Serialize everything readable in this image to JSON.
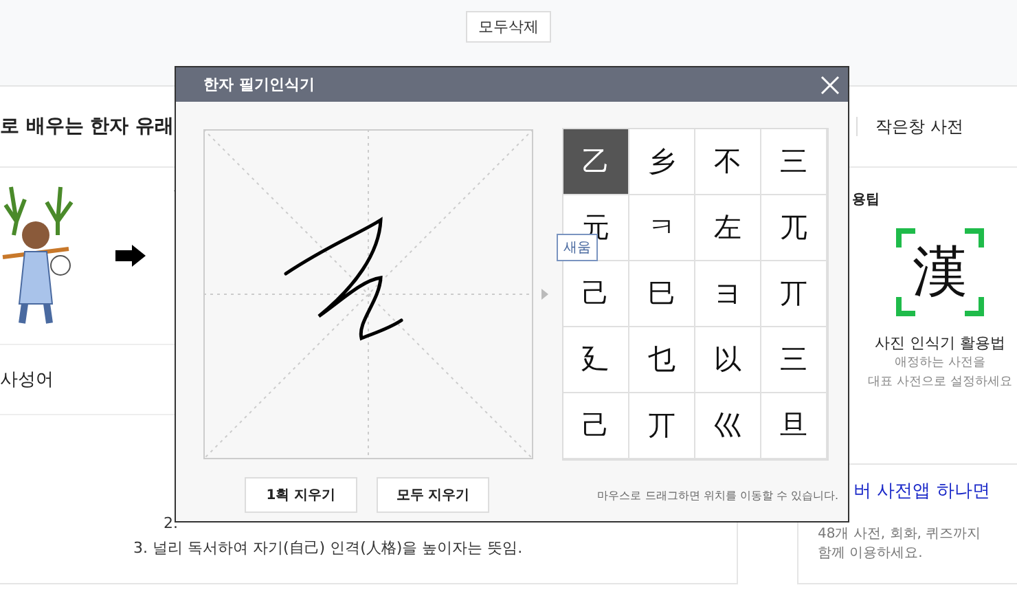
{
  "top_bar": {
    "clear_all_button": "모두삭제"
  },
  "left_panel": {
    "heading": "로 배우는 한자 유래",
    "section_heading": "사성어",
    "lines": [
      "2.",
      "3. 널리 독서하여 자기(自己) 인격(人格)을 높이자는 뜻임."
    ]
  },
  "right_panel": {
    "small_window_link": "작은창 사전",
    "tip_heading": "용팁",
    "photo_icon_char": "漢",
    "photo_title": "사진 인식기 활용법",
    "photo_desc": [
      "애정하는 사전을",
      "대표 사전으로 설정하세요"
    ],
    "ad": {
      "title": "버 사전앱 하나면",
      "desc": [
        "48개 사전, 회화, 퀴즈까지",
        "함께 이용하세요."
      ]
    }
  },
  "dialog": {
    "title": "한자 필기인식기",
    "candidates": [
      {
        "char": "乙",
        "selected": true
      },
      {
        "char": "乡",
        "selected": false
      },
      {
        "char": "不",
        "selected": false
      },
      {
        "char": "三",
        "selected": false
      },
      {
        "char": "元",
        "selected": false
      },
      {
        "char": "ㅋ",
        "selected": false
      },
      {
        "char": "左",
        "selected": false
      },
      {
        "char": "兀",
        "selected": false
      },
      {
        "char": "己",
        "selected": false
      },
      {
        "char": "巳",
        "selected": false
      },
      {
        "char": "ヨ",
        "selected": false
      },
      {
        "char": "丌",
        "selected": false
      },
      {
        "char": "廴",
        "selected": false
      },
      {
        "char": "乜",
        "selected": false
      },
      {
        "char": "以",
        "selected": false
      },
      {
        "char": "三",
        "selected": false
      },
      {
        "char": "己",
        "selected": false
      },
      {
        "char": "丌",
        "selected": false
      },
      {
        "char": "巛",
        "selected": false
      },
      {
        "char": "旦",
        "selected": false
      }
    ],
    "tooltip": "새움",
    "buttons": [
      "1획 지우기",
      "모두 지우기"
    ],
    "hint": "마우스로 드래그하면 위치를 이동할 수 있습니다."
  }
}
